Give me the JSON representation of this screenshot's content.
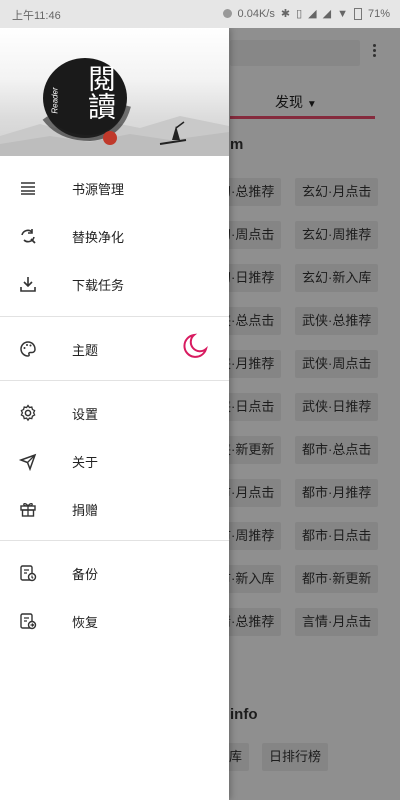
{
  "status_bar": {
    "time": "上午11:46",
    "network_speed": "0.04K/s",
    "battery": "71%"
  },
  "background": {
    "tab_label": "发现",
    "section1_suffix": "m",
    "section2_suffix": "info",
    "chips": [
      "玄幻·总推荐",
      "玄幻·月点击",
      "玄幻·周点击",
      "玄幻·周推荐",
      "玄幻·日推荐",
      "玄幻·新入库",
      "武侠·总点击",
      "武侠·总推荐",
      "武侠·月推荐",
      "武侠·周点击",
      "武侠·日点击",
      "武侠·日推荐",
      "武侠·新更新",
      "都市·总点击",
      "都市·月点击",
      "都市·月推荐",
      "都市·周推荐",
      "都市·日点击",
      "都市·新入库",
      "都市·新更新",
      "言情·总推荐",
      "言情·月点击"
    ],
    "chips_bottom": [
      "库",
      "日排行榜"
    ]
  },
  "drawer": {
    "logo_text": "閱讀",
    "logo_sub": "Reader",
    "menu": [
      {
        "label": "书源管理",
        "icon": "list-icon"
      },
      {
        "label": "替换净化",
        "icon": "find-replace-icon"
      },
      {
        "label": "下载任务",
        "icon": "download-icon"
      },
      {
        "label": "主题",
        "icon": "palette-icon"
      },
      {
        "label": "设置",
        "icon": "gear-icon"
      },
      {
        "label": "关于",
        "icon": "send-icon"
      },
      {
        "label": "捐赠",
        "icon": "gift-icon"
      },
      {
        "label": "备份",
        "icon": "backup-icon"
      },
      {
        "label": "恢复",
        "icon": "restore-icon"
      }
    ]
  },
  "colors": {
    "accent": "#d81b60",
    "drawer_bg": "#ffffff",
    "divider": "#e2e2e2"
  }
}
